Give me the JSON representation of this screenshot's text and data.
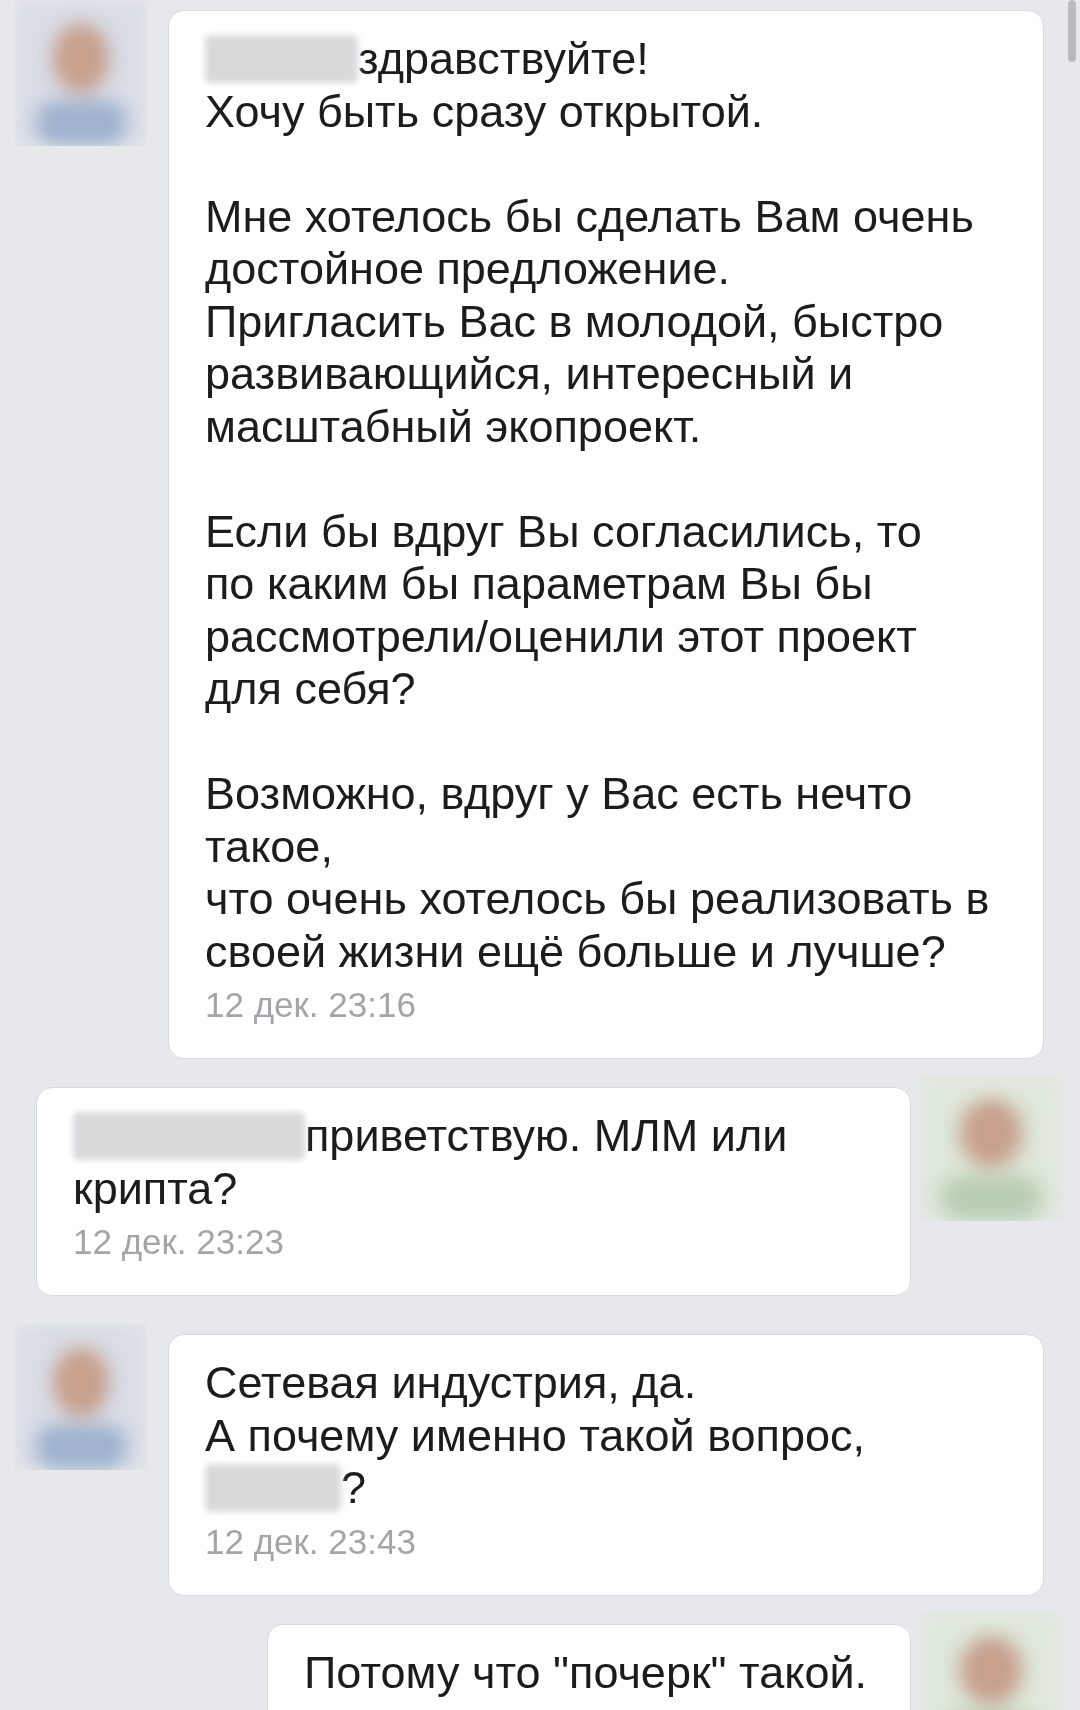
{
  "messages": [
    {
      "kind": "incoming",
      "blocks": [
        [
          {
            "kind": "redacted"
          },
          {
            "kind": "text",
            "text": "здравствуйте!"
          }
        ],
        [
          {
            "kind": "text",
            "text": "Хочу быть сразу открытой.\n\nМне хотелось бы сделать Вам очень\nдостойное предложение.\nПригласить Вас в молодой, быстро\nразвивающийся, интересный и\nмасштабный экопроект.\n\nЕсли бы вдруг Вы согласились, то\nпо каким бы параметрам Вы бы\nрассмотрели/оценили этот проект\nдля себя?\n\nВозможно, вдруг у Вас есть нечто\nтакое,\nчто очень хотелось бы реализовать в\nсвоей жизни ещё больше и лучше?"
          }
        ]
      ],
      "time": "12 дек. 23:16"
    },
    {
      "kind": "outgoing",
      "blocks": [
        [
          {
            "kind": "redacted"
          },
          {
            "kind": "text",
            "text": "приветствую. МЛМ или"
          }
        ],
        [
          {
            "kind": "text",
            "text": "крипта?"
          }
        ]
      ],
      "time": "12 дек. 23:23"
    },
    {
      "kind": "incoming",
      "blocks": [
        [
          {
            "kind": "text",
            "text": "Сетевая индустрия, да.\nА почему именно такой вопрос,"
          }
        ],
        [
          {
            "kind": "redacted"
          },
          {
            "kind": "text",
            "text": "?"
          }
        ]
      ],
      "time": "12 дек. 23:43"
    },
    {
      "kind": "outgoing",
      "blocks": [
        [
          {
            "kind": "text",
            "text": "Потому что \"почерк\" такой."
          }
        ]
      ]
    }
  ]
}
